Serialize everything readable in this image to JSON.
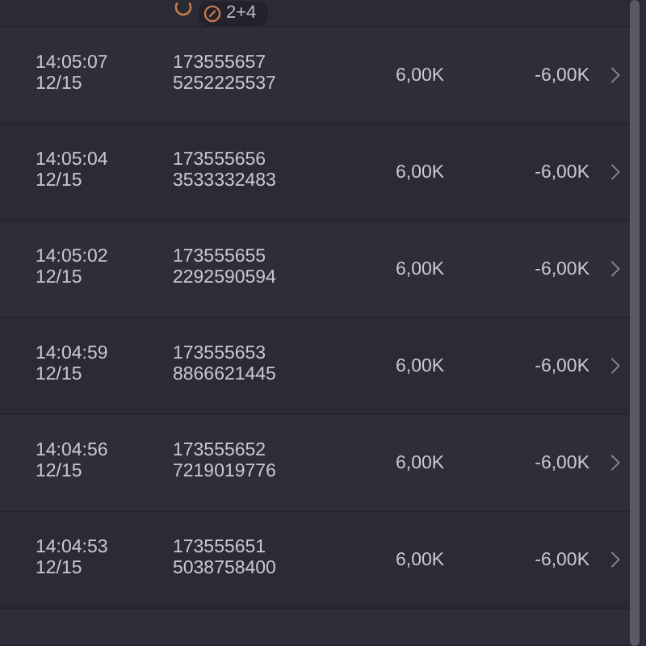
{
  "top_row": {
    "badge": "2+4"
  },
  "rows": [
    {
      "time": "14:05:07",
      "date": "12/15",
      "id_line_1": "173555657",
      "id_line_2": "5252225537",
      "amount": "6,00K",
      "change": "-6,00K"
    },
    {
      "time": "14:05:04",
      "date": "12/15",
      "id_line_1": "173555656",
      "id_line_2": "3533332483",
      "amount": "6,00K",
      "change": "-6,00K"
    },
    {
      "time": "14:05:02",
      "date": "12/15",
      "id_line_1": "173555655",
      "id_line_2": "2292590594",
      "amount": "6,00K",
      "change": "-6,00K"
    },
    {
      "time": "14:04:59",
      "date": "12/15",
      "id_line_1": "173555653",
      "id_line_2": "8866621445",
      "amount": "6,00K",
      "change": "-6,00K"
    },
    {
      "time": "14:04:56",
      "date": "12/15",
      "id_line_1": "173555652",
      "id_line_2": "7219019776",
      "amount": "6,00K",
      "change": "-6,00K"
    },
    {
      "time": "14:04:53",
      "date": "12/15",
      "id_line_1": "173555651",
      "id_line_2": "5038758400",
      "amount": "6,00K",
      "change": "-6,00K"
    }
  ]
}
